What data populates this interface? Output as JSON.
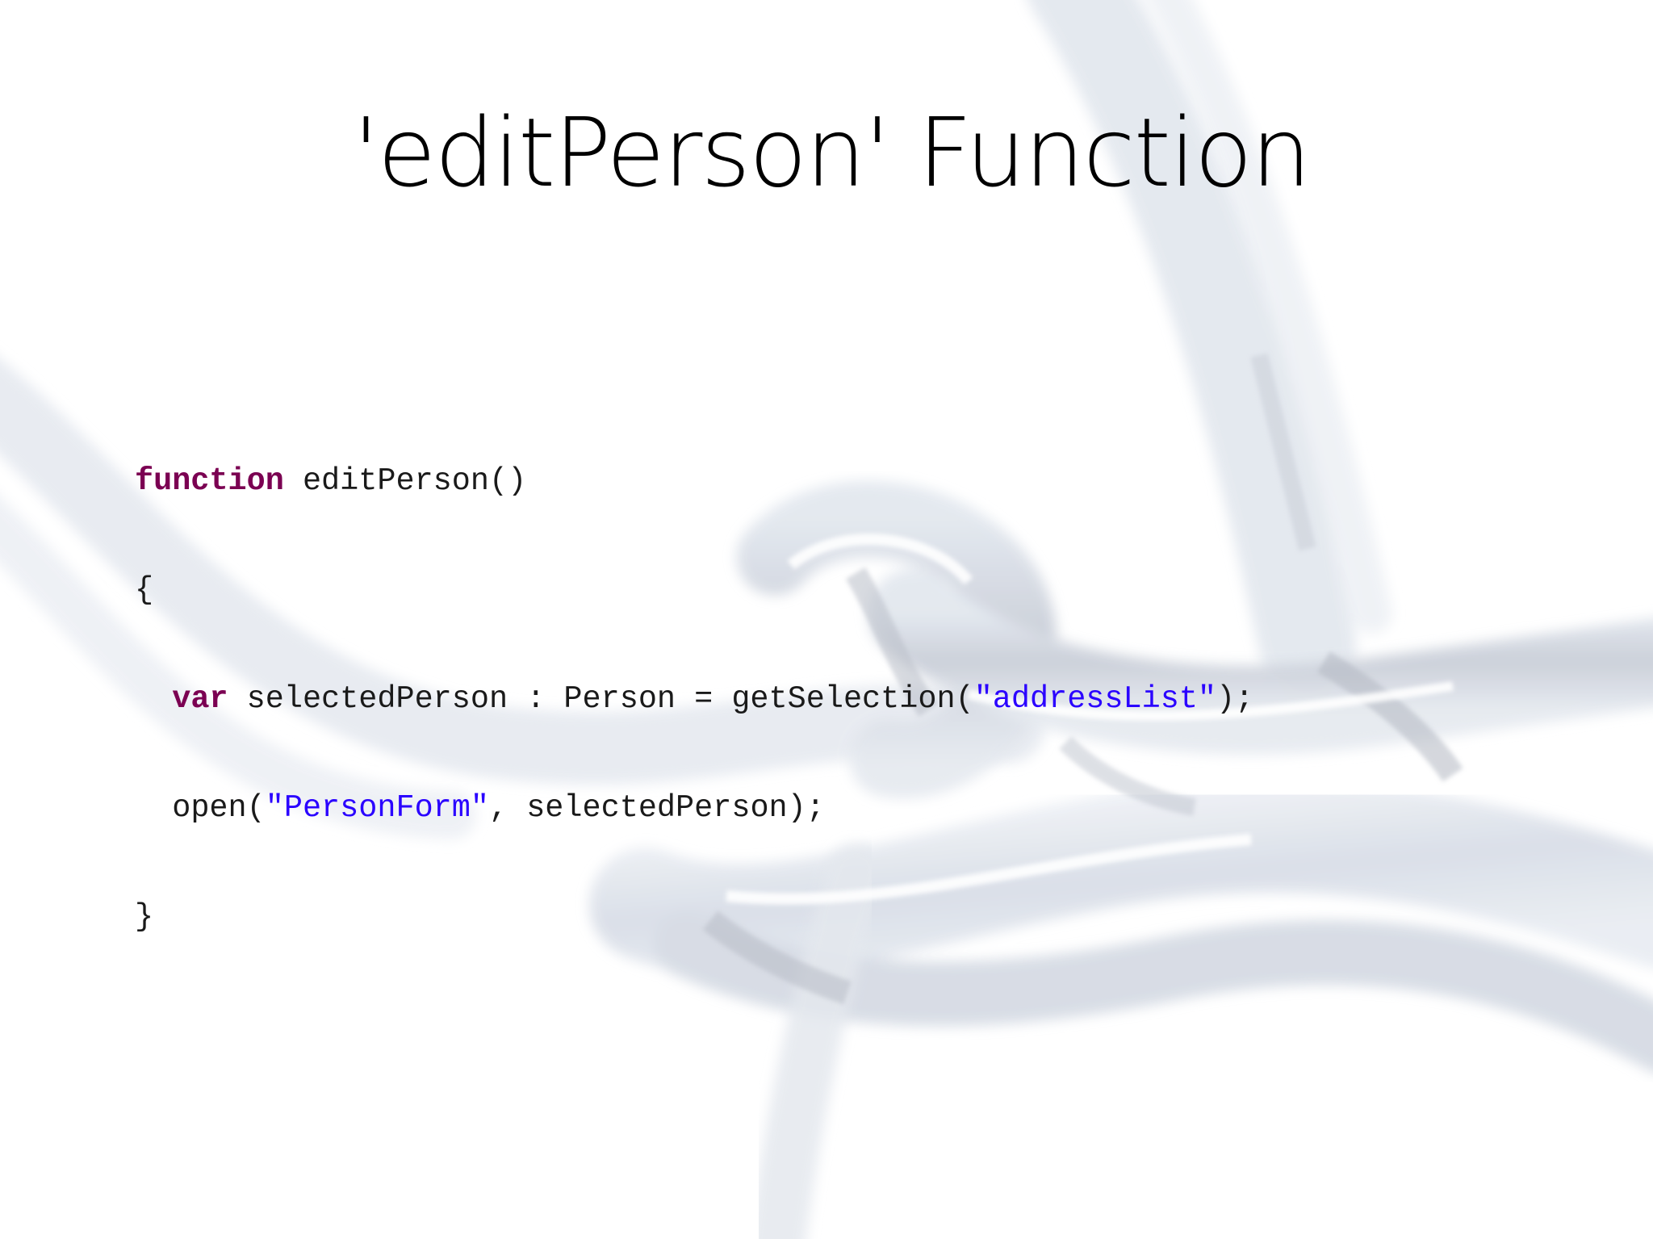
{
  "slide": {
    "title": "'editPerson' Function"
  },
  "code": {
    "colors": {
      "keyword": "#7b0052",
      "string": "#2a00ff",
      "text": "#1a1a1a"
    },
    "lines": {
      "l1": {
        "kw": "function",
        "rest": " editPerson()"
      },
      "l2": {
        "text": "{"
      },
      "l3": {
        "indent": "  ",
        "kw": "var",
        "mid": " selectedPerson : Person = getSelection(",
        "str": "\"addressList\"",
        "end": ");"
      },
      "l4": {
        "indent": "  ",
        "pre": "open(",
        "str": "\"PersonForm\"",
        "end": ", selectedPerson);"
      },
      "l5": {
        "text": "}"
      }
    }
  }
}
